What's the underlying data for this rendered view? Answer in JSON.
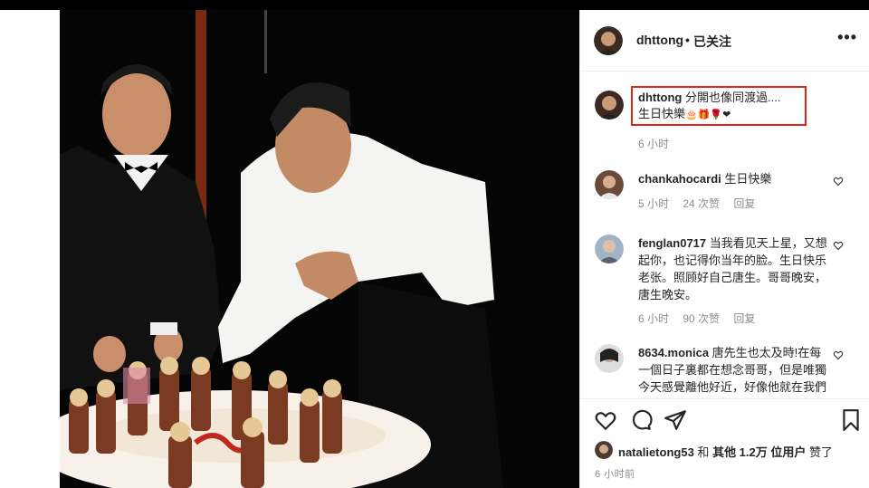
{
  "post": {
    "author": "dhttong",
    "follow_status": "已关注",
    "more": "•••"
  },
  "caption": {
    "username": "dhttong",
    "line1": "分開也像同渡過....",
    "line2": "生日快樂",
    "emoji": "🎂🎁🌹❤",
    "time": "6 小时"
  },
  "comments": [
    {
      "username": "chankahocardi",
      "text": "生日快樂",
      "time": "5 小时",
      "likes": "24 次赞",
      "reply": "回复"
    },
    {
      "username": "fenglan0717",
      "text": "当我看见天上星，又想起你，也记得你当年的脸。生日快乐老张。照顾好自己唐生。哥哥晚安，唐生晚安。",
      "time": "6 小时",
      "likes": "90 次赞",
      "reply": "回复"
    },
    {
      "username": "8634.monica",
      "text": "唐先生也太及時!在每一個日子裏都在想念哥哥，但是唯獨今天感覺離他好近，好像他就在我們身邊一起慶生一樣。",
      "time": "",
      "likes": "",
      "reply": ""
    }
  ],
  "likes": {
    "user": "natalietong53",
    "and": "和",
    "others": "其他 1.2万 位用户",
    "suffix": "赞了"
  },
  "post_time": "6 小时前",
  "colors": {
    "highlight_box": "#e0241c",
    "muted_text": "#8e8e8e",
    "divider": "#efefef"
  },
  "icons": [
    "more-icon",
    "heart-icon",
    "comment-icon",
    "share-icon",
    "bookmark-icon"
  ]
}
